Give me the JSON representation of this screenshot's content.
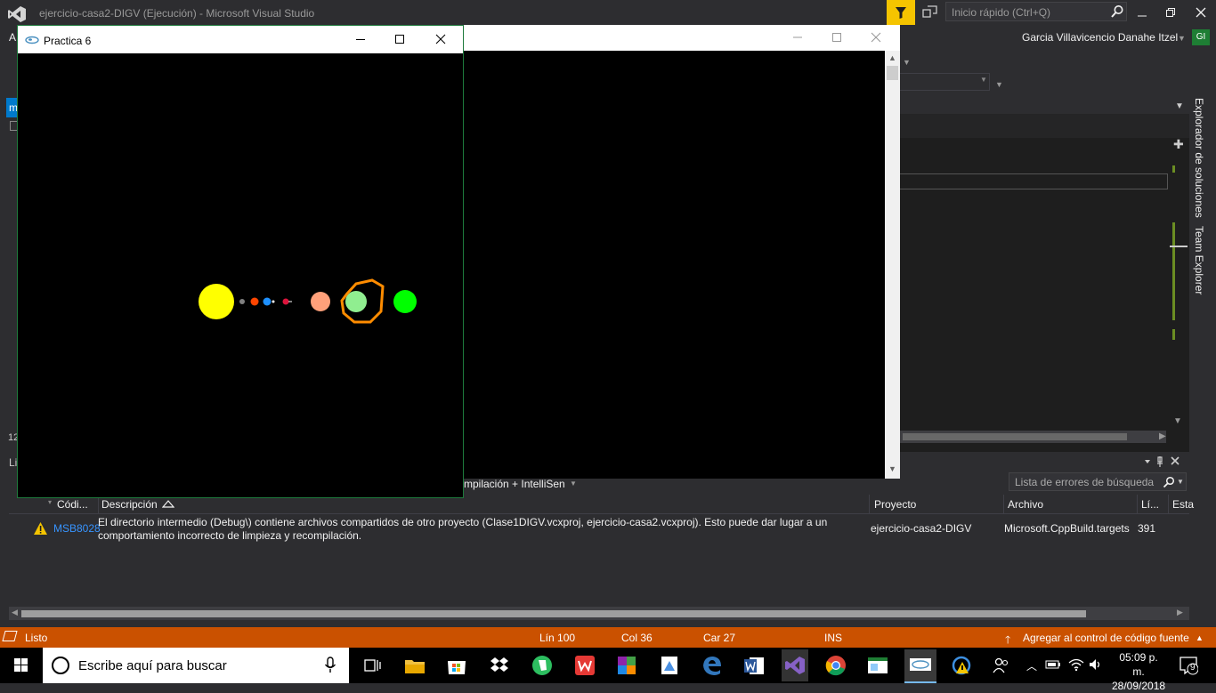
{
  "vs": {
    "title": "ejercicio-casa2-DIGV (Ejecución) - Microsoft Visual Studio",
    "quick_launch_placeholder": "Inicio rápido (Ctrl+Q)",
    "user_name": "Garcia Villavicencio Danahe Itzel",
    "user_initials": "GI",
    "left_fragment": "A",
    "left_tab_fragment": "m",
    "left_line_fragment": "12",
    "left_panel_fragment": "Li",
    "side_tabs": [
      "Explorador de soluciones",
      "Team Explorer"
    ],
    "accent_color": "#007acc",
    "filter_color": "#f5c400"
  },
  "practica_window": {
    "title": "Practica 6",
    "planets": [
      {
        "name": "sun",
        "color": "#ffff00"
      },
      {
        "name": "mercury",
        "color": "#808080"
      },
      {
        "name": "venus",
        "color": "#ff4500"
      },
      {
        "name": "earth",
        "color": "#1e90ff"
      },
      {
        "name": "mars",
        "color": "#dc143c"
      },
      {
        "name": "jupiter",
        "color": "#ffa07a"
      },
      {
        "name": "saturn",
        "color": "#90ee90",
        "ring_color": "#ff8c00"
      },
      {
        "name": "uranus",
        "color": "#00ff00"
      }
    ]
  },
  "error_list": {
    "filter_label_fragment": "mpilación + IntelliSen",
    "search_placeholder": "Lista de errores de búsqueda",
    "columns": {
      "code": "Códi...",
      "description": "Descripción",
      "project": "Proyecto",
      "file": "Archivo",
      "line": "Lí...",
      "state": "Esta"
    },
    "rows": [
      {
        "severity": "warning",
        "code": "MSB8028",
        "description": "El directorio intermedio (Debug\\) contiene archivos compartidos de otro proyecto (Clase1DIGV.vcxproj, ejercicio-casa2.vcxproj). Esto puede dar lugar a un comportamiento incorrecto de limpieza y recompilación.",
        "project": "ejercicio-casa2-DIGV",
        "file": "Microsoft.CppBuild.targets",
        "line": "391"
      }
    ]
  },
  "status_bar": {
    "state": "Listo",
    "line": "Lín 100",
    "col": "Col 36",
    "char": "Car 27",
    "mode": "INS",
    "source_control": "Agregar al control de código fuente",
    "color": "#ca5100"
  },
  "taskbar": {
    "search_placeholder": "Escribe aquí para buscar",
    "time": "05:09 p. m.",
    "date": "28/09/2018",
    "notifications": "9",
    "apps": [
      "task-view",
      "file-explorer",
      "store",
      "dropbox",
      "evernote",
      "wps",
      "winrar",
      "paint",
      "edge",
      "word",
      "visual-studio",
      "chrome",
      "app-window",
      "console-app"
    ]
  }
}
